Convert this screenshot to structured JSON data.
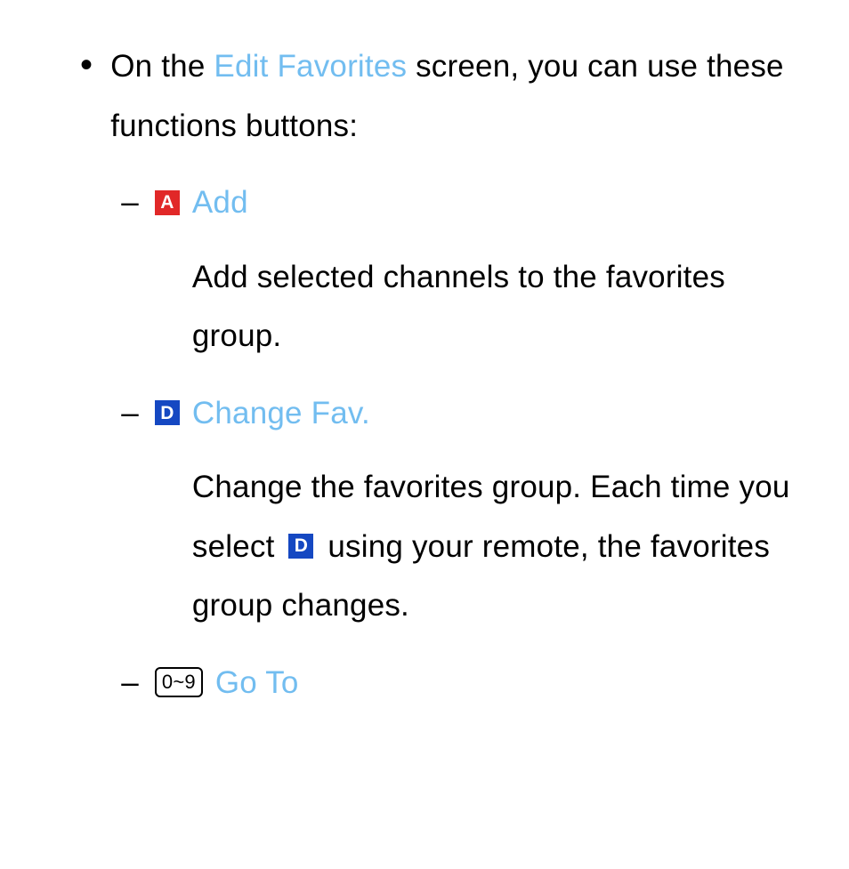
{
  "main": {
    "intro_pre": "On the ",
    "intro_link": "Edit Favorites",
    "intro_post": " screen, you can use these functions buttons:",
    "items": [
      {
        "dash": "–",
        "keyLetter": "a",
        "keyLabel": "A",
        "title": "Add",
        "desc": "Add selected channels to the favorites group."
      },
      {
        "dash": "–",
        "keyLetter": "d",
        "keyLabel": "D",
        "title": "Change Fav.",
        "desc_pre": "Change the favorites group. Each time you select ",
        "desc_inline_key": "D",
        "desc_post": " using your remote, the favorites group changes."
      },
      {
        "dash": "–",
        "keyLetter": "num",
        "keyLabel": "0~9",
        "title": "Go To"
      }
    ]
  },
  "colors": {
    "accent": "#72bdf0",
    "redKey": "#e12828",
    "blueKey": "#1548c2"
  }
}
